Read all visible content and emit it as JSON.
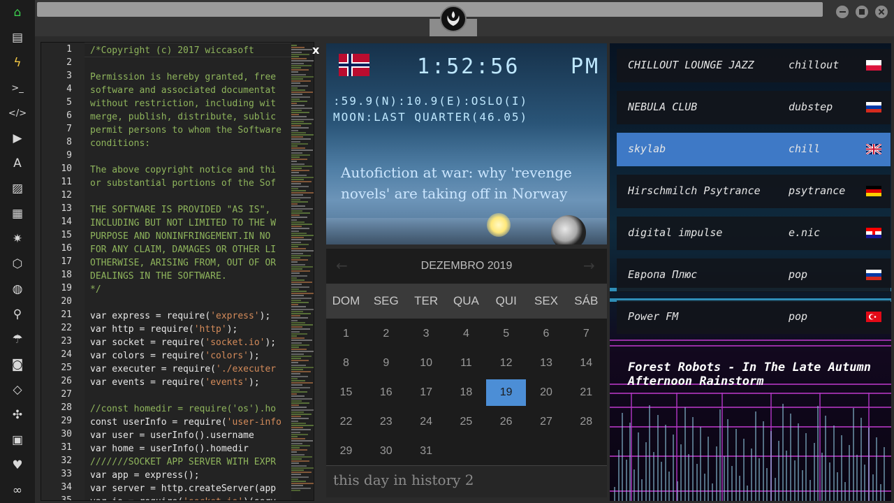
{
  "sidebar": {
    "icons": [
      "home-icon",
      "file-icon",
      "lightning-icon",
      "terminal-icon",
      "code-icon",
      "play-icon",
      "translate-icon",
      "image-icon",
      "news-icon",
      "settings-icon",
      "cube-icon",
      "globe-icon",
      "search-icon",
      "umbrella-icon",
      "contact-icon",
      "dev-icon",
      "expand-icon",
      "youtube-icon",
      "heart-icon",
      "infinity-icon"
    ],
    "accent": "#3ccf4e"
  },
  "editor": {
    "close_label": "x",
    "line_numbers": [
      "1",
      "2",
      "3",
      "4",
      "5",
      "6",
      "7",
      "8",
      "9",
      "10",
      "11",
      "12",
      "13",
      "14",
      "15",
      "16",
      "17",
      "18",
      "19",
      "20",
      "21",
      "22",
      "23",
      "24",
      "25",
      "26",
      "27",
      "28",
      "29",
      "30",
      "31",
      "32",
      "33",
      "34",
      "35"
    ],
    "lines": [
      [
        [
          "/*Copyright (c) 2017 wiccasoft",
          "c-cmt"
        ]
      ],
      [],
      [
        [
          "Permission is hereby granted, free",
          "c-cmt"
        ]
      ],
      [
        [
          "software and associated documentat",
          "c-cmt"
        ]
      ],
      [
        [
          "without restriction, including wit",
          "c-cmt"
        ]
      ],
      [
        [
          "merge, publish, distribute, sublic",
          "c-cmt"
        ]
      ],
      [
        [
          "permit persons to whom the Software",
          "c-cmt"
        ]
      ],
      [
        [
          "conditions:",
          "c-cmt"
        ]
      ],
      [],
      [
        [
          "The above copyright notice and thi",
          "c-cmt"
        ]
      ],
      [
        [
          "or substantial portions of the Sof",
          "c-cmt"
        ]
      ],
      [],
      [
        [
          "THE SOFTWARE IS PROVIDED \"AS IS\",",
          "c-cmt"
        ]
      ],
      [
        [
          "INCLUDING BUT NOT LIMITED TO THE W",
          "c-cmt"
        ]
      ],
      [
        [
          "PURPOSE AND NONINFRINGEMENT.IN NO",
          "c-cmt"
        ]
      ],
      [
        [
          "FOR ANY CLAIM, DAMAGES OR OTHER LI",
          "c-cmt"
        ]
      ],
      [
        [
          "OTHERWISE, ARISING FROM, OUT OF OR",
          "c-cmt"
        ]
      ],
      [
        [
          "DEALINGS IN THE SOFTWARE.",
          "c-cmt"
        ]
      ],
      [
        [
          "*/",
          "c-cmt"
        ]
      ],
      [],
      [
        [
          "var express = require(",
          "c-kw"
        ],
        [
          "'express'",
          "c-str"
        ],
        [
          ");",
          "c-kw"
        ]
      ],
      [
        [
          "var http = require(",
          "c-kw"
        ],
        [
          "'http'",
          "c-str"
        ],
        [
          ");",
          "c-kw"
        ]
      ],
      [
        [
          "var socket = require(",
          "c-kw"
        ],
        [
          "'socket.io'",
          "c-str"
        ],
        [
          ");",
          "c-kw"
        ]
      ],
      [
        [
          "var colors = require(",
          "c-kw"
        ],
        [
          "'colors'",
          "c-str"
        ],
        [
          ");",
          "c-kw"
        ]
      ],
      [
        [
          "var executer = require(",
          "c-kw"
        ],
        [
          "'./executer",
          "c-str"
        ]
      ],
      [
        [
          "var events = require(",
          "c-kw"
        ],
        [
          "'events'",
          "c-str"
        ],
        [
          ");",
          "c-kw"
        ]
      ],
      [],
      [
        [
          "//const homedir = require('os').ho",
          "c-cmt"
        ]
      ],
      [
        [
          "const userInfo = require(",
          "c-kw"
        ],
        [
          "'user-info",
          "c-str"
        ]
      ],
      [
        [
          "var user = userInfo().username",
          "c-kw"
        ]
      ],
      [
        [
          "var home = userInfo().homedir",
          "c-kw"
        ]
      ],
      [
        [
          "///////SOCKET APP SERVER WITH EXPR",
          "c-cmt"
        ]
      ],
      [
        [
          "var app = express();",
          "c-kw"
        ]
      ],
      [
        [
          "var server = http.createServer(app",
          "c-kw"
        ]
      ],
      [
        [
          "var io = require(",
          "c-kw"
        ],
        [
          "'socket.io'",
          "c-str"
        ],
        [
          ")(serv",
          "c-kw"
        ]
      ]
    ]
  },
  "clock": {
    "time": "1:52:56",
    "ampm": "PM",
    "location": ":59.9(N):10.9(E):OSLO(I)",
    "moon": "MOON:LAST QUARTER(46.05)",
    "headline": "Autofiction at war: why 'revenge novels' are taking off in Norway",
    "flag_icon": "norway-flag-icon"
  },
  "calendar": {
    "title": "DEZEMBRO 2019",
    "prev_icon": "arrow-left-icon",
    "next_icon": "arrow-right-icon",
    "day_names": [
      "DOM",
      "SEG",
      "TER",
      "QUA",
      "QUI",
      "SEX",
      "SÁB"
    ],
    "weeks": [
      [
        "1",
        "2",
        "3",
        "4",
        "5",
        "6",
        "7"
      ],
      [
        "8",
        "9",
        "10",
        "11",
        "12",
        "13",
        "14"
      ],
      [
        "15",
        "16",
        "17",
        "18",
        "19",
        "20",
        "21"
      ],
      [
        "22",
        "23",
        "24",
        "25",
        "26",
        "27",
        "28"
      ],
      [
        "29",
        "30",
        "31"
      ]
    ],
    "today": "19",
    "footer": "this day in history 2",
    "today_color": "#4c8ed6"
  },
  "radio": {
    "stations": [
      {
        "name": "CHILLOUT LOUNGE JAZZ",
        "genre": "chillout",
        "flag": "poland-flag-icon"
      },
      {
        "name": "NEBULA CLUB",
        "genre": "dubstep",
        "flag": "russia-flag-icon"
      },
      {
        "name": "skylab",
        "genre": "chill",
        "flag": "uk-flag-icon",
        "active": true
      },
      {
        "name": "Hirschmilch Psytrance",
        "genre": "psytrance",
        "flag": "germany-flag-icon"
      },
      {
        "name": "digital impulse",
        "genre": "e.nic",
        "flag": "croatia-flag-icon"
      },
      {
        "name": "Европа Плюс",
        "genre": "pop",
        "flag": "russia-flag-icon"
      },
      {
        "name": "Power FM",
        "genre": "pop",
        "flag": "turkey-flag-icon"
      }
    ],
    "now_playing": "Forest Robots - In The Late Autumn Afternoon Rainstorm",
    "active_color": "#3e79c6"
  }
}
